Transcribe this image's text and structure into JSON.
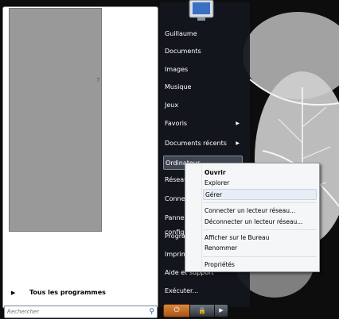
{
  "right_pane": {
    "items": [
      {
        "label": "Guillaume",
        "has_arrow": false
      },
      {
        "label": "Documents",
        "has_arrow": false
      },
      {
        "label": "Images",
        "has_arrow": false
      },
      {
        "label": "Musique",
        "has_arrow": false
      },
      {
        "label": "Jeux",
        "has_arrow": false
      },
      {
        "label": "Favoris",
        "has_arrow": true
      },
      {
        "label": "Documents récents",
        "has_arrow": true
      },
      {
        "label": "Ordinateur",
        "has_arrow": false
      },
      {
        "label": "Réseau",
        "has_arrow": false
      },
      {
        "label": "Connexion",
        "has_arrow": false
      },
      {
        "label": "Panneau de configuration",
        "has_arrow": false
      },
      {
        "label": "Programmes par défaut",
        "has_arrow": false
      },
      {
        "label": "Imprimantes",
        "has_arrow": false
      },
      {
        "label": "Aide et support",
        "has_arrow": false
      },
      {
        "label": "Exécuter...",
        "has_arrow": false
      }
    ]
  },
  "left_pane": {
    "stray_text": "7",
    "all_programs_label": "Tous les programmes"
  },
  "search": {
    "placeholder": "Rechercher"
  },
  "context_menu": {
    "items": [
      {
        "label": "Ouvrir",
        "bold": true
      },
      {
        "label": "Explorer",
        "bold": false
      },
      {
        "label": "Gérer",
        "bold": false,
        "highlighted": true
      },
      {
        "label": "Connecter un lecteur réseau...",
        "bold": false
      },
      {
        "label": "Déconnecter un lecteur réseau...",
        "bold": false
      },
      {
        "label": "Afficher sur le Bureau",
        "bold": false
      },
      {
        "label": "Renommer",
        "bold": false
      },
      {
        "label": "Propriétés",
        "bold": false
      }
    ]
  },
  "icons": {
    "search": "search-icon",
    "power": "power-icon",
    "lock": "lock-icon",
    "arrow": "arrow-right-icon"
  },
  "colors": {
    "right_pane": "#12161c",
    "power_button": "#c06a2a",
    "menu_highlight": "#e8eef6"
  }
}
